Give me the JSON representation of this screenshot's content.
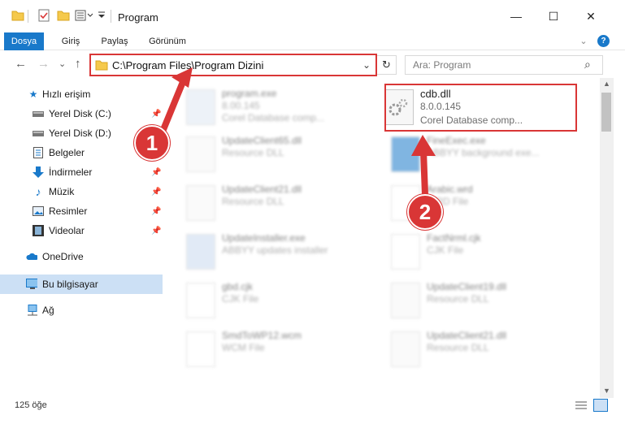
{
  "window": {
    "title": "Program",
    "minimize": "—",
    "maximize": "☐",
    "close": "✕"
  },
  "ribbon": {
    "tabs": [
      {
        "label": "Dosya",
        "active": true
      },
      {
        "label": "Giriş",
        "active": false
      },
      {
        "label": "Paylaş",
        "active": false
      },
      {
        "label": "Görünüm",
        "active": false
      }
    ],
    "expand": "⌄",
    "help": "?"
  },
  "nav": {
    "back": "←",
    "forward": "→",
    "recent": "⌄",
    "up": "↑",
    "address": "C:\\Program Files\\Program Dizini",
    "dropdown": "⌄",
    "refresh": "↻",
    "search_placeholder": "Ara: Program",
    "search_icon": "⌕"
  },
  "sidebar": {
    "items": [
      {
        "label": "Hızlı erişim",
        "icon": "star-icon",
        "pinned": false
      },
      {
        "label": "Yerel Disk (C:)",
        "icon": "drive-icon",
        "pinned": true
      },
      {
        "label": "Yerel Disk (D:)",
        "icon": "drive-icon",
        "pinned": true
      },
      {
        "label": "Belgeler",
        "icon": "documents-icon",
        "pinned": true
      },
      {
        "label": "İndirmeler",
        "icon": "download-icon",
        "pinned": true
      },
      {
        "label": "Müzik",
        "icon": "music-icon",
        "pinned": true
      },
      {
        "label": "Resimler",
        "icon": "pictures-icon",
        "pinned": true
      },
      {
        "label": "Videolar",
        "icon": "videos-icon",
        "pinned": true
      },
      {
        "label": "OneDrive",
        "icon": "cloud-icon",
        "pinned": false
      },
      {
        "label": "Bu bilgisayar",
        "icon": "computer-icon",
        "pinned": false,
        "selected": true
      },
      {
        "label": "Ağ",
        "icon": "network-icon",
        "pinned": false
      }
    ]
  },
  "files": [
    {
      "name": "program.exe",
      "line2": "8.00.145",
      "line3": "Corel Database comp..."
    },
    {
      "name": "cdb.dll",
      "line2": "8.0.0.145",
      "line3": "Corel Database comp..."
    },
    {
      "name": "UpdateClient65.dll",
      "line2": "Resource DLL",
      "line3": ""
    },
    {
      "name": "FineExec.exe",
      "line2": "ABBYY background exe...",
      "line3": ""
    },
    {
      "name": "UpdateClient21.dll",
      "line2": "Resource DLL",
      "line3": ""
    },
    {
      "name": "Arabic.wrd",
      "line2": "WRD File",
      "line3": ""
    },
    {
      "name": "UpdateInstaller.exe",
      "line2": "ABBYY updates installer",
      "line3": ""
    },
    {
      "name": "FactNrml.cjk",
      "line2": "CJK File",
      "line3": ""
    },
    {
      "name": "gbd.cjk",
      "line2": "CJK File",
      "line3": ""
    },
    {
      "name": "UpdateClient19.dll",
      "line2": "Resource DLL",
      "line3": ""
    },
    {
      "name": "SmdToWP12.wcm",
      "line2": "WCM File",
      "line3": ""
    },
    {
      "name": "UpdateClient21.dll",
      "line2": "Resource DLL",
      "line3": ""
    }
  ],
  "status": {
    "count": "125 öğe"
  },
  "annotations": {
    "step1": "1",
    "step2": "2",
    "color": "#d93636"
  }
}
